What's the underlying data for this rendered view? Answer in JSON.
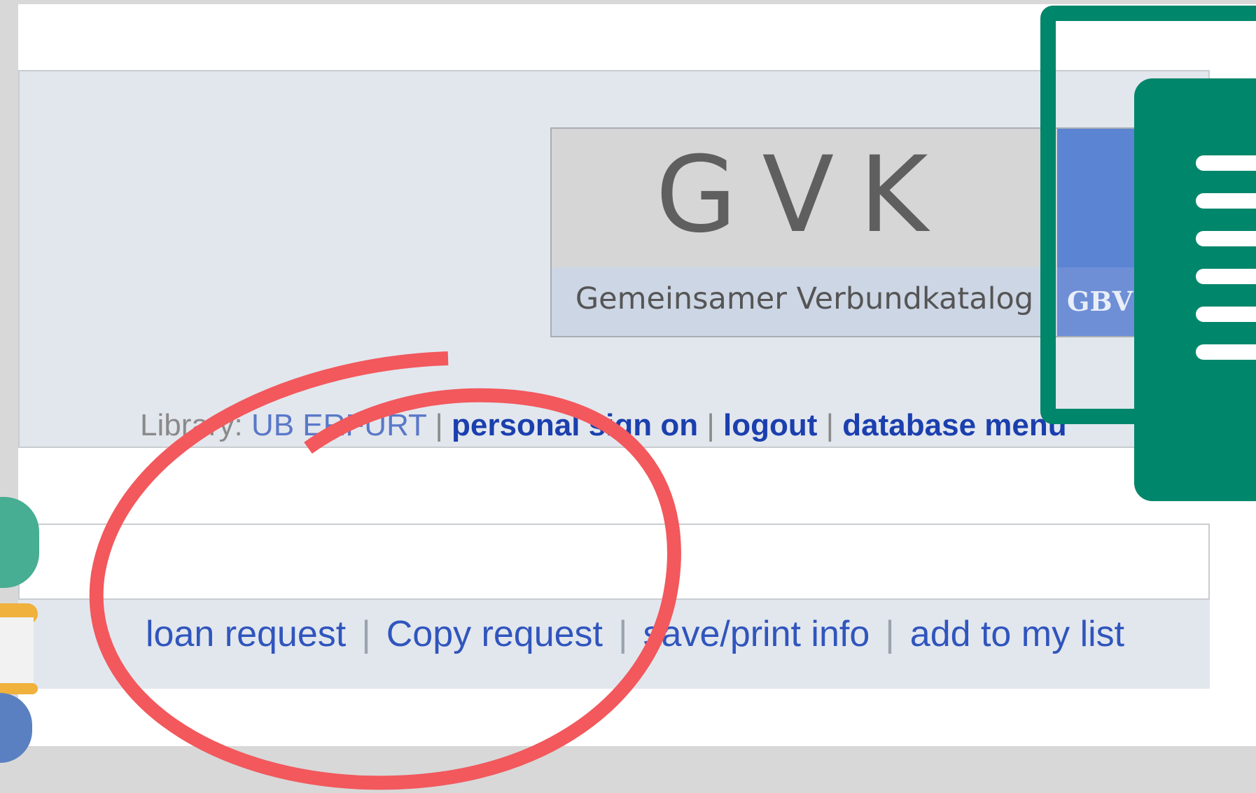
{
  "logo": {
    "letters": "GVK",
    "subtitle": "Gemeinsamer Verbundkatalog",
    "badge": "GBV"
  },
  "header": {
    "library_label": "Library:",
    "library_name": "UB ERFURT",
    "sep": "|",
    "personal_sign_on": "personal sign on",
    "logout": "logout",
    "database_menu": "database menu"
  },
  "actions": {
    "loan_request": "loan request",
    "copy_request": "Copy request",
    "save_print_info": "save/print info",
    "add_to_my_list": "add to my list",
    "sep": "|"
  },
  "icons": {
    "document": "document-icon",
    "books": "books-illustration",
    "annotation": "red-circle-annotation"
  },
  "colors": {
    "link_bold": "#1b3fae",
    "link": "#3055bd",
    "header_bg": "#e2e7ee",
    "accent_green": "#00866a",
    "annotation_red": "#f2585c"
  }
}
